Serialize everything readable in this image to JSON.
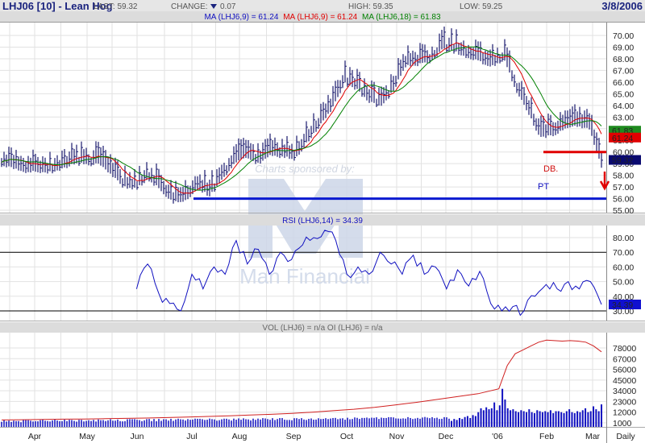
{
  "header": {
    "title": "LHJ06 [10] - Lean Hog",
    "last": "LAST: 59.32",
    "change_label": "CHANGE:",
    "change_value": "0.07",
    "high": "HIGH: 59.35",
    "low": "LOW: 59.25",
    "date": "3/8/2006"
  },
  "ma_legend": {
    "ma1": "MA (LHJ6,9) = 61.24",
    "ma2": "MA (LHJ6,9) = 61.24",
    "ma3": "MA (LHJ6,18) = 61.83"
  },
  "annotations": {
    "db": "DB.",
    "pt": "PT",
    "sponsor": "Charts sponsored by:",
    "sponsor_name": "Man Financial"
  },
  "colors": {
    "ma_fast": "#e00000",
    "ma_slow": "#008000",
    "bars": "#1a1a6e",
    "rsi": "#1010c0",
    "oi": "#d02020",
    "vol": "#1010c0"
  },
  "chart_data": [
    {
      "type": "ohlc",
      "title": "LHJ06 [10] - Lean Hog",
      "x_labels": [
        "Apr",
        "May",
        "Jun",
        "Jul",
        "Aug",
        "Sep",
        "Oct",
        "Nov",
        "Dec",
        "'06",
        "Feb",
        "Mar",
        "Daily"
      ],
      "y_ticks": [
        "70.00",
        "69.00",
        "68.00",
        "67.00",
        "66.00",
        "65.00",
        "64.00",
        "63.00",
        "62.00",
        "61.00",
        "60.00",
        "59.00",
        "58.00",
        "57.00",
        "56.00",
        "55.00"
      ],
      "ylim": [
        55,
        70.5
      ],
      "closes": [
        59.5,
        59.2,
        58.9,
        58.9,
        58.9,
        59.2,
        59.6,
        59.6,
        59.5,
        58.6,
        57.6,
        57.5,
        58.3,
        57.3,
        56.3,
        56.4,
        57.5,
        56.8,
        58.3,
        59.6,
        60.1,
        59.6,
        60.3,
        60.2,
        60.0,
        61.5,
        62.9,
        64.3,
        66.5,
        66.0,
        64.9,
        64.5,
        65.9,
        68.0,
        68.1,
        68.4,
        69.4,
        69.2,
        68.8,
        68.4,
        67.9,
        68.6,
        66.0,
        64.0,
        61.8,
        62.0,
        62.6,
        62.8,
        62.6,
        59.3
      ],
      "badges": [
        {
          "value": "61.83",
          "color": "#1f8a1f"
        },
        {
          "value": "61.24",
          "color": "#e00000"
        },
        {
          "value": "59.32",
          "color": "#0a0a70"
        }
      ],
      "support_level": 60.0,
      "target_level": 56.0
    },
    {
      "type": "line",
      "title": "RSI (LHJ6,14) = 34.39",
      "y_ticks": [
        "80.00",
        "70.00",
        "60.00",
        "50.00",
        "40.00",
        "30.00"
      ],
      "ylim": [
        27,
        86
      ],
      "reference_lines": [
        70,
        30
      ],
      "current": "34.39",
      "values": [
        45,
        62,
        42,
        35,
        30,
        55,
        45,
        60,
        55,
        78,
        62,
        72,
        55,
        70,
        65,
        75,
        80,
        85,
        78,
        55,
        60,
        55,
        70,
        62,
        55,
        68,
        55,
        60,
        45,
        58,
        47,
        57,
        35,
        30,
        33,
        30,
        40,
        48,
        45,
        50,
        45,
        50,
        34.39
      ],
      "start_fraction": 0.225
    },
    {
      "type": "bar+line",
      "title": "VOL (LHJ6) = n/a OI (LHJ6) = n/a",
      "y_ticks": [
        "78000",
        "67000",
        "56000",
        "45000",
        "34000",
        "23000",
        "12000",
        "1000"
      ],
      "ylim": [
        0,
        90000
      ],
      "open_interest": [
        4000,
        4200,
        4500,
        4800,
        5000,
        5300,
        5600,
        6000,
        6500,
        7000,
        7600,
        8300,
        9000,
        9800,
        10800,
        12000,
        13500,
        15000,
        17000,
        19500,
        22000,
        25000,
        28000,
        31000,
        36000,
        60000,
        72000,
        76000,
        80000,
        84000,
        86000,
        85500,
        85000,
        85500,
        85000,
        84000,
        80000,
        74000
      ],
      "volume_recent": [
        3000,
        5000,
        4000,
        6000,
        5000,
        7000,
        8000,
        6000,
        9000,
        8000,
        12000,
        16000,
        14000,
        17000,
        15000,
        16000,
        22000,
        14000,
        19000,
        36000,
        25000,
        16000,
        14000,
        15000,
        13000,
        12000,
        14000,
        13000,
        12000,
        15000,
        12000,
        11000,
        14000,
        13000,
        12000,
        13000,
        12000,
        14000,
        11000,
        13000,
        13000,
        12000,
        11000,
        13000,
        15000,
        12000,
        11000,
        13000,
        12000,
        14000,
        16000,
        12000,
        13000,
        18000,
        15000,
        13000,
        20000
      ]
    }
  ]
}
